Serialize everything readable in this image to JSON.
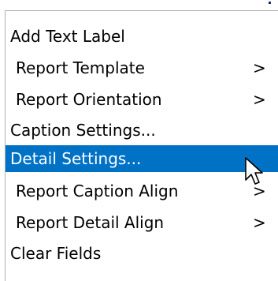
{
  "menu": {
    "items": [
      {
        "label": "Add Text Label",
        "arrow": ""
      },
      {
        "label": "Report Template",
        "arrow": ">"
      },
      {
        "label": "Report Orientation",
        "arrow": ">"
      },
      {
        "label": "Caption Settings...",
        "arrow": ""
      },
      {
        "label": "Detail Settings...",
        "arrow": ""
      },
      {
        "label": "Report Caption Align",
        "arrow": ">"
      },
      {
        "label": "Report Detail Align",
        "arrow": ">"
      },
      {
        "label": "Clear Fields",
        "arrow": ""
      }
    ],
    "selected_index": 4
  },
  "colors": {
    "selection": "#0072c6",
    "selection_text": "#ffffff",
    "text": "#000000"
  },
  "icons": {
    "cursor": "arrow-pointer-icon"
  }
}
